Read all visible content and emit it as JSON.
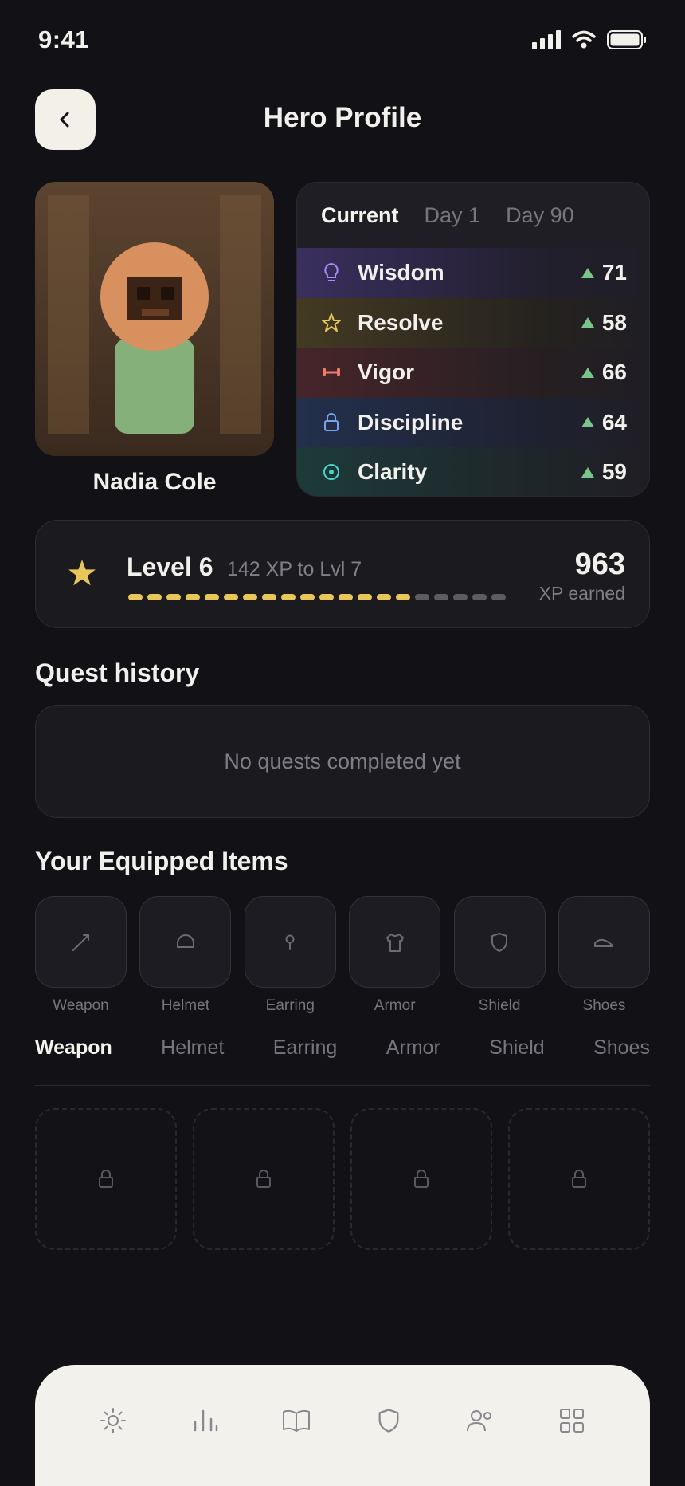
{
  "status": {
    "time": "9:41"
  },
  "header": {
    "title": "Hero Profile"
  },
  "hero": {
    "name": "Nadia Cole"
  },
  "stats": {
    "tabs": [
      {
        "label": "Current",
        "active": true
      },
      {
        "label": "Day 1",
        "active": false
      },
      {
        "label": "Day 90",
        "active": false
      }
    ],
    "rows": [
      {
        "label": "Wisdom",
        "value": "71",
        "icon": "lightbulb-icon",
        "color": "#a78bfa"
      },
      {
        "label": "Resolve",
        "value": "58",
        "icon": "star-outline-icon",
        "color": "#e9c65a"
      },
      {
        "label": "Vigor",
        "value": "66",
        "icon": "dumbbell-icon",
        "color": "#f07a6a"
      },
      {
        "label": "Discipline",
        "value": "64",
        "icon": "lock-icon",
        "color": "#7aa2f0"
      },
      {
        "label": "Clarity",
        "value": "59",
        "icon": "target-icon",
        "color": "#4fd1c5"
      }
    ]
  },
  "level": {
    "title": "Level 6",
    "subtitle": "142 XP to Lvl 7",
    "xp": "963",
    "xp_label": "XP earned",
    "progress_segments_filled": 15,
    "progress_segments_total": 20
  },
  "quests": {
    "title": "Quest history",
    "empty": "No quests completed yet"
  },
  "equipped": {
    "title": "Your Equipped Items",
    "slots": [
      {
        "label": "Weapon",
        "icon": "sword-icon"
      },
      {
        "label": "Helmet",
        "icon": "helmet-icon"
      },
      {
        "label": "Earring",
        "icon": "earring-icon"
      },
      {
        "label": "Armor",
        "icon": "armor-icon"
      },
      {
        "label": "Shield",
        "icon": "shield-icon"
      },
      {
        "label": "Shoes",
        "icon": "shoe-icon"
      }
    ]
  },
  "categories": {
    "tabs": [
      {
        "label": "Weapon",
        "active": true
      },
      {
        "label": "Helmet",
        "active": false
      },
      {
        "label": "Earring",
        "active": false
      },
      {
        "label": "Armor",
        "active": false
      },
      {
        "label": "Shield",
        "active": false
      },
      {
        "label": "Shoes",
        "active": false
      }
    ]
  },
  "nav": {
    "items": [
      {
        "icon": "sun-icon"
      },
      {
        "icon": "bars-icon"
      },
      {
        "icon": "book-icon"
      },
      {
        "icon": "shield-icon"
      },
      {
        "icon": "people-icon"
      },
      {
        "icon": "grid-icon"
      }
    ]
  },
  "colors": {
    "accent": "#e9c65a",
    "up": "#7ac68a",
    "background": "#121116"
  }
}
